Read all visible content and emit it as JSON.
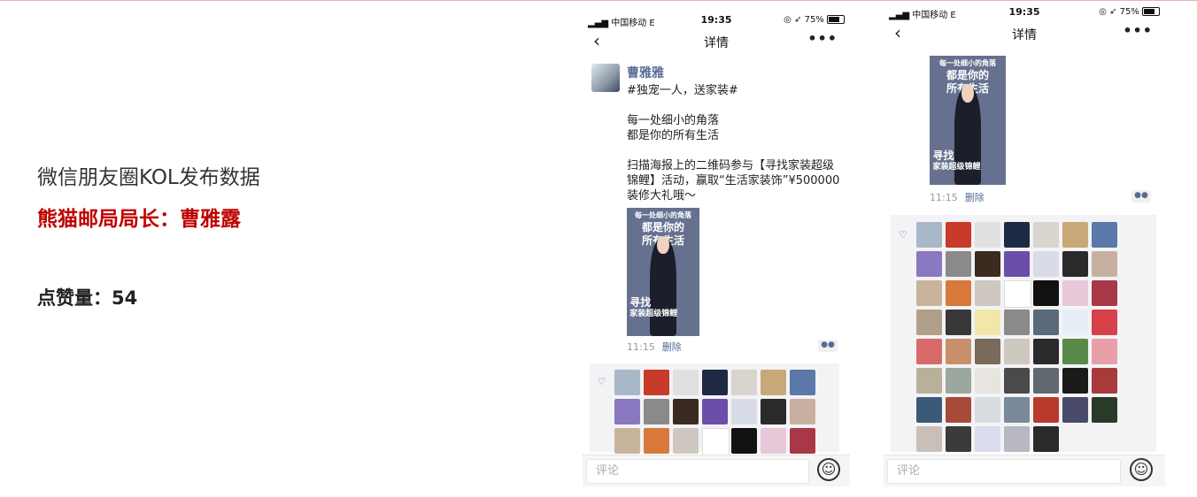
{
  "slide": {
    "title": "微信朋友圈KOL发布数据",
    "subtitle": "熊猫邮局局长：曹雅露",
    "likes": "点赞量：54"
  },
  "phone1": {
    "carrier": "中国移动 E",
    "time": "19:35",
    "battery": "75%",
    "nav_title": "详情",
    "author": "曹雅雅",
    "post_text": "#独宠一人，送家装#\n\n每一处细小的角落\n都是你的所有生活\n\n扫描海报上的二维码参与【寻找家装超级锦鲤】活动，赢取“生活家装饰”¥500000装修大礼哦～",
    "poster_line1": "每一处细小的角落",
    "poster_line2": "都是你的",
    "poster_line3": "所有生活",
    "poster_foot1": "寻找",
    "poster_foot2": "家装超级锦鲤",
    "time_ago": "11:15",
    "delete": "删除",
    "comment_placeholder": "评论"
  },
  "phone2": {
    "carrier": "中国移动 E",
    "time": "19:35",
    "battery": "75%",
    "nav_title": "详情",
    "poster_line1": "每一处细小的角落",
    "poster_line2": "都是你的",
    "poster_line3": "所有生活",
    "poster_foot1": "寻找",
    "poster_foot2": "家装超级锦鲤",
    "time_ago": "11:15",
    "delete": "删除",
    "comment_placeholder": "评论"
  },
  "icons": {
    "back": "chevron-left-icon",
    "more": "more-icon",
    "like": "heart-icon",
    "emoji": "emoji-icon"
  },
  "colors": {
    "accent_red": "#c00000",
    "wechat_link": "#576b95"
  },
  "like_avatars_phone1": [
    "#a8b8c8",
    "#c83a2a",
    "#e0e0e0",
    "#1e2a44",
    "#d8d4ce",
    "#c8a878",
    "#5a78a8",
    "#8a78c0",
    "#8a8a8a",
    "#3a2a20",
    "#6a4ea8",
    "#d8dce6",
    "#2a2a2a",
    "#c8b0a0",
    "#c8b49c",
    "#d8783a",
    "#cfc8c0",
    "#ffffff",
    "#111111",
    "#e6c8d8",
    "#a83848"
  ],
  "like_avatars_phone2": [
    "#a8b8c8",
    "#c83a2a",
    "#e0e0e0",
    "#1e2a44",
    "#d8d4ce",
    "#c8a878",
    "#5a78a8",
    "#8a78c0",
    "#8a8a8a",
    "#3a2a20",
    "#6a4ea8",
    "#d8dce6",
    "#2a2a2a",
    "#c8b0a0",
    "#c8b49c",
    "#d8783a",
    "#cfc8c0",
    "#ffffff",
    "#111111",
    "#e6c8d8",
    "#a83848",
    "#b0a088",
    "#383838",
    "#f2e6a8",
    "#8a8a8a",
    "#5a6a7a",
    "#e8eef6",
    "#d8404a",
    "#d86a6a",
    "#c8906a",
    "#7a6a5a",
    "#cfc8c0",
    "#2a2a2a",
    "#5a8a4a",
    "#e8a0a8",
    "#b8b098",
    "#9aa8a0",
    "#e8e4e0",
    "#4a4a4a",
    "#606870",
    "#1a1a1a",
    "#a83a3a",
    "#3a5a7a",
    "#a84a3a",
    "#d8dce0",
    "#7a8a9a",
    "#b83a2a",
    "#4a4a6a",
    "#2a3a2a",
    "#c8c0b8",
    "#3a3a3a",
    "#d8dcec",
    "#b8b8c0",
    "#2a2a2a"
  ]
}
